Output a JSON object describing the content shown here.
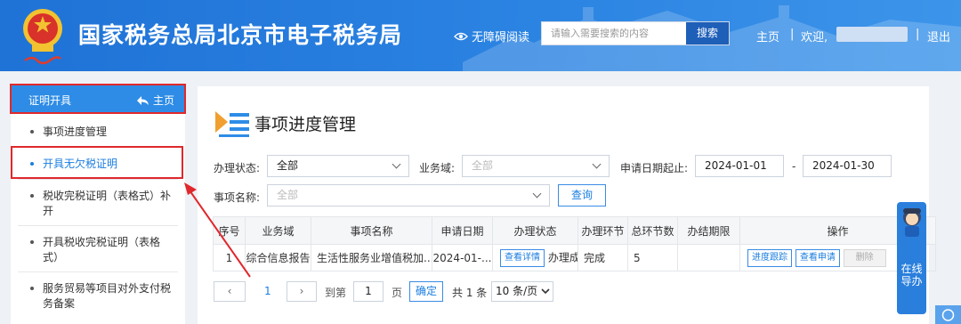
{
  "header": {
    "site_title": "国家税务总局北京市电子税务局",
    "accessibility_label": "无障碍阅读",
    "search_placeholder": "请输入需要搜索的内容",
    "search_button": "搜索",
    "home_link": "主页",
    "welcome_text": "欢迎,",
    "logout_link": "退出",
    "separator": "|"
  },
  "sidebar": {
    "section_title": "证明开具",
    "home_label": "主页",
    "items": [
      {
        "label": "事项进度管理"
      },
      {
        "label": "开具无欠税证明"
      },
      {
        "label": "税收完税证明（表格式）补开"
      },
      {
        "label": "开具税收完税证明（表格式）"
      },
      {
        "label": "服务贸易等项目对外支付税务备案"
      }
    ]
  },
  "main": {
    "page_title": "事项进度管理",
    "filters": {
      "status_label": "办理状态:",
      "status_value": "全部",
      "domain_label": "业务域:",
      "domain_placeholder": "全部",
      "date_label": "申请日期起止:",
      "date_from": "2024-01-01",
      "date_sep": "-",
      "date_to": "2024-01-30",
      "item_label": "事项名称:",
      "item_placeholder": "全部",
      "query_button": "查询"
    },
    "table": {
      "headers": [
        "序号",
        "业务域",
        "事项名称",
        "申请日期",
        "办理状态",
        "办理环节",
        "总环节数",
        "办结期限",
        "操作"
      ],
      "rows": [
        {
          "seq": "1",
          "domain": "综合信息报告",
          "item": "生活性服务业增值税加...",
          "date": "2024-01-...",
          "status_button": "查看详情",
          "status_text": "办理成功",
          "step": "完成",
          "total_steps": "5",
          "deadline": "",
          "actions": [
            "进度跟踪",
            "查看申请",
            "删除"
          ]
        }
      ]
    },
    "pagination": {
      "prev": "‹",
      "current_page": "1",
      "next": "›",
      "goto_label": "到第",
      "goto_value": "1",
      "page_unit": "页",
      "confirm": "确定",
      "total": "共 1 条",
      "page_size": "10 条/页"
    }
  },
  "floating": {
    "guide_label": "在线导办"
  },
  "colors": {
    "header_blue": "#2b83e2",
    "accent": "#1a7de0",
    "highlight_red": "#e0282c"
  }
}
